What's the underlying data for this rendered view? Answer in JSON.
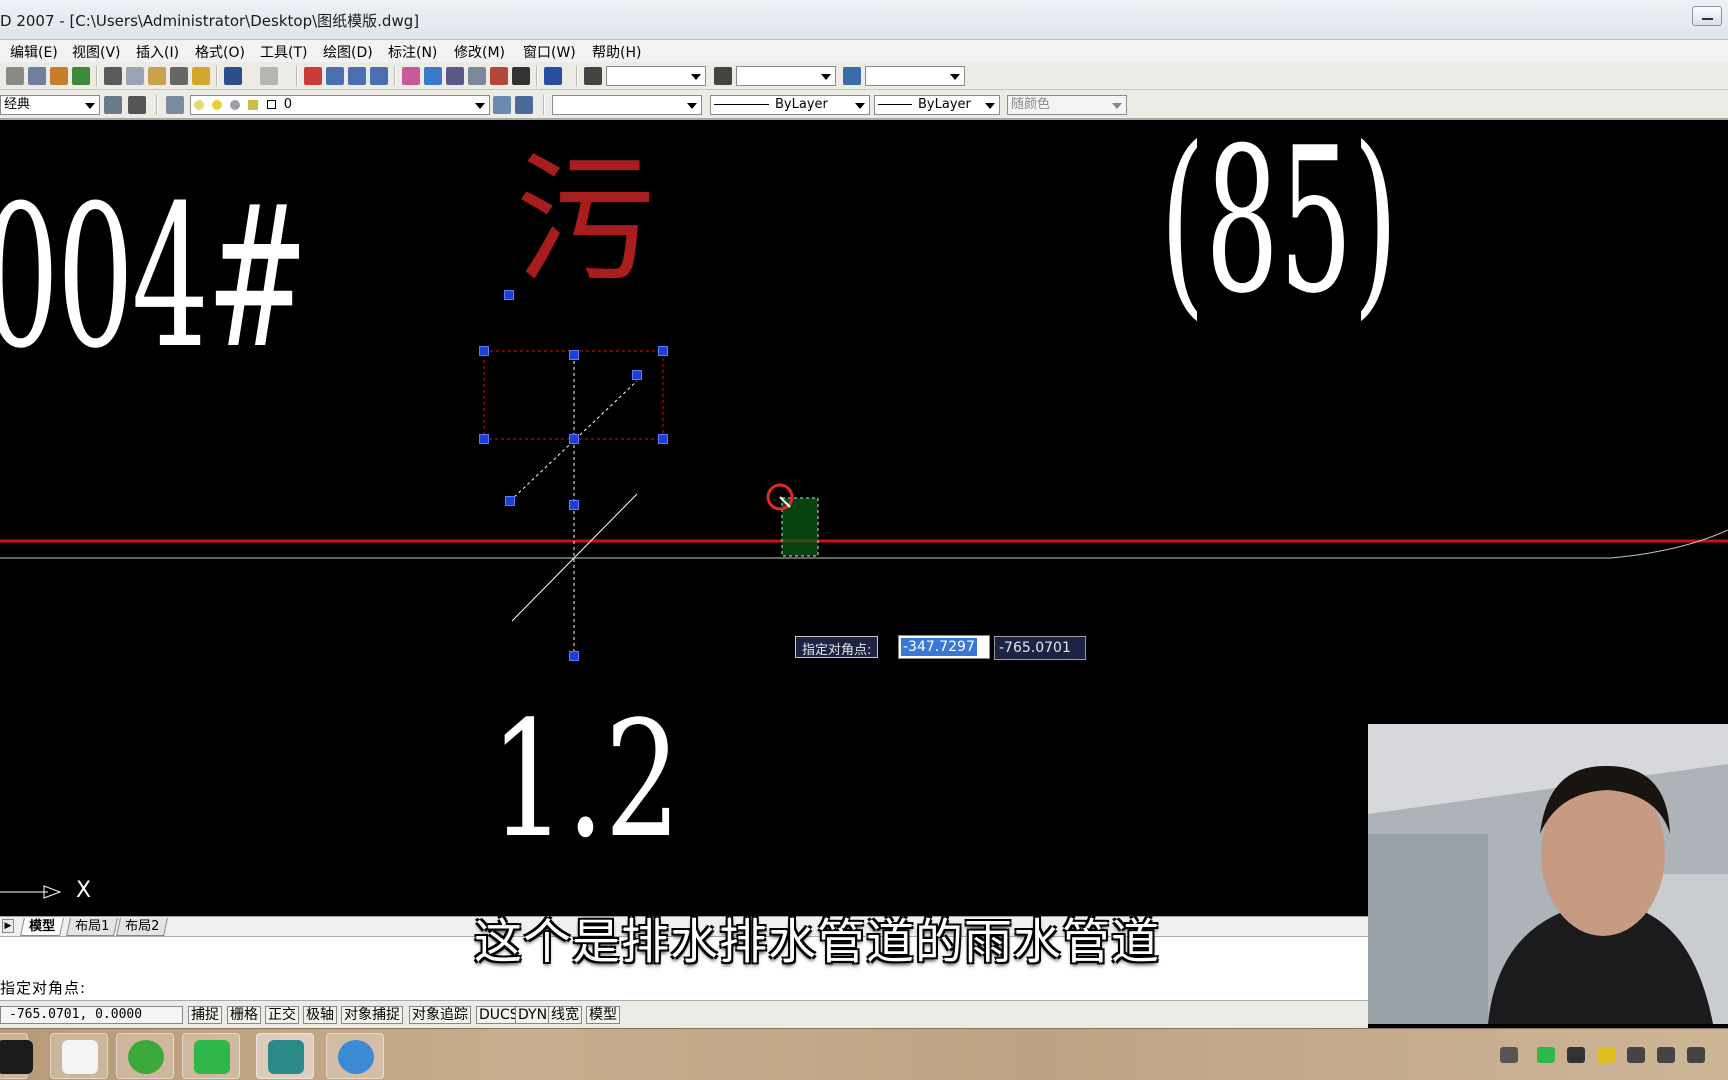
{
  "window": {
    "title": "D 2007 - [C:\\Users\\Administrator\\Desktop\\图纸模版.dwg]"
  },
  "menu": [
    "编辑(E)",
    "视图(V)",
    "插入(I)",
    "格式(O)",
    "工具(T)",
    "绘图(D)",
    "标注(N)",
    "修改(M)",
    "窗口(W)",
    "帮助(H)"
  ],
  "toolbar2": {
    "workspace": "经典",
    "layer": "0",
    "linetype": "ByLayer",
    "lineweight": "ByLayer",
    "plotstyle": "随颜色"
  },
  "drawing": {
    "text_004": "004#",
    "text_wu": "污",
    "text_85": "(85)",
    "text_12": "1.2",
    "axis_label": "X"
  },
  "colors": {
    "pipe_red": "#d01010",
    "wu_red": "#a81e1e",
    "grip_blue": "#1c3fd6"
  },
  "dynamic_input": {
    "prompt": "指定对角点:",
    "x_value": "-347.7297",
    "y_value": "-765.0701"
  },
  "layout_tabs": [
    "模型",
    "布局1",
    "布局2"
  ],
  "command_line": {
    "text": "指定对角点:"
  },
  "status_bar": {
    "coords": "-765.0701, 0.0000",
    "buttons": [
      "捕捉",
      "栅格",
      "正交",
      "极轴",
      "对象捕捉",
      "对象追踪",
      "DUCS",
      "DYN",
      "线宽",
      "模型"
    ]
  },
  "subtitle": "这个是排水排水管道的雨水管道",
  "taskbar": {
    "apps": [
      "camera-app",
      "baidu-netdisk",
      "ie-browser",
      "wechat",
      "autocad",
      "browser-app"
    ]
  }
}
